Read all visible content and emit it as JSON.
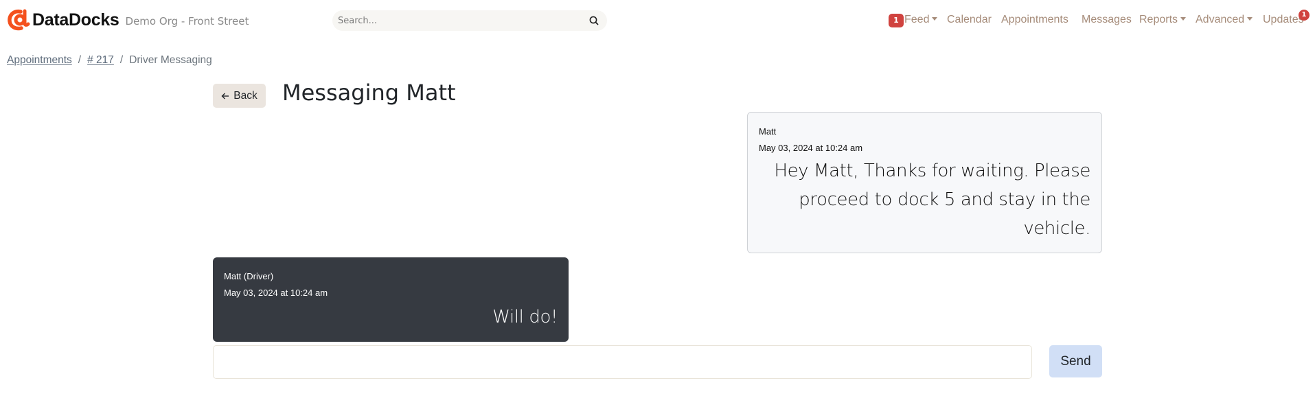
{
  "brand": {
    "name": "DataDocks",
    "org": "Demo Org - Front Street",
    "logo_color": "#f4511e"
  },
  "search": {
    "placeholder": "Search...",
    "value": "",
    "icon": "search-icon"
  },
  "nav": {
    "feed": {
      "label": "Feed",
      "badge": "1"
    },
    "calendar": {
      "label": "Calendar"
    },
    "appointments": {
      "label": "Appointments"
    },
    "messages": {
      "label": "Messages"
    },
    "reports": {
      "label": "Reports"
    },
    "advanced": {
      "label": "Advanced"
    },
    "updates": {
      "label": "Updates",
      "badge": "1"
    },
    "link_color": "#a68c7a",
    "badge_color": "#d0433f"
  },
  "breadcrumb": {
    "items": [
      {
        "label": "Appointments",
        "link": true
      },
      {
        "label": "# 217",
        "link": true
      },
      {
        "label": "Driver Messaging",
        "link": false
      }
    ],
    "separator": "/"
  },
  "header": {
    "back_label": "Back",
    "title": "Messaging Matt"
  },
  "messages": [
    {
      "direction": "received",
      "author": "Matt",
      "timestamp": "May 03, 2024 at 10:24 am",
      "text": "Hey Matt, Thanks for waiting. Please proceed to dock 5 and stay in the vehicle."
    },
    {
      "direction": "sent",
      "author": "Matt (Driver)",
      "timestamp": "May 03, 2024 at 10:24 am",
      "text": "Will do!"
    }
  ],
  "composer": {
    "value": "",
    "placeholder": "",
    "send_label": "Send"
  }
}
